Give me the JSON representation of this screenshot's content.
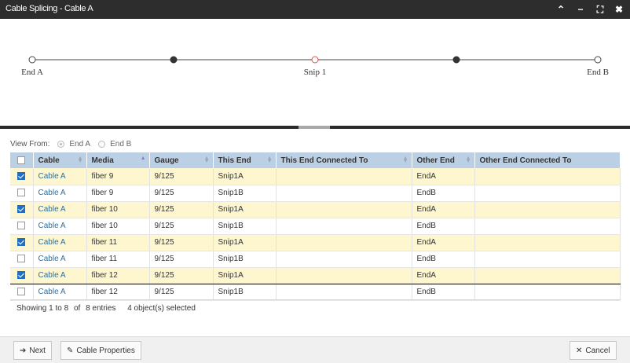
{
  "window": {
    "title": "Cable Splicing - Cable A",
    "controls": {
      "collapse": "⌃",
      "minimize": "−",
      "maximize": "⛶",
      "close": "✖"
    }
  },
  "diagram": {
    "nodes": [
      {
        "label": "End A",
        "style": "open"
      },
      {
        "label": "",
        "style": "filled"
      },
      {
        "label": "Snip 1",
        "style": "open-red"
      },
      {
        "label": "",
        "style": "filled"
      },
      {
        "label": "End B",
        "style": "open"
      }
    ]
  },
  "view_from": {
    "label": "View From:",
    "options": [
      {
        "label": "End A",
        "selected": true
      },
      {
        "label": "End B",
        "selected": false
      }
    ]
  },
  "table": {
    "columns": [
      "Cable",
      "Media",
      "Gauge",
      "This End",
      "This End Connected To",
      "Other End",
      "Other End Connected To"
    ],
    "sorted_column": "Media",
    "rows": [
      {
        "checked": true,
        "cable": "Cable A",
        "media": "fiber 9",
        "gauge": "9/125",
        "this_end": "Snip1A",
        "this_conn": "",
        "other_end": "EndA",
        "other_conn": ""
      },
      {
        "checked": false,
        "cable": "Cable A",
        "media": "fiber 9",
        "gauge": "9/125",
        "this_end": "Snip1B",
        "this_conn": "",
        "other_end": "EndB",
        "other_conn": ""
      },
      {
        "checked": true,
        "cable": "Cable A",
        "media": "fiber 10",
        "gauge": "9/125",
        "this_end": "Snip1A",
        "this_conn": "",
        "other_end": "EndA",
        "other_conn": ""
      },
      {
        "checked": false,
        "cable": "Cable A",
        "media": "fiber 10",
        "gauge": "9/125",
        "this_end": "Snip1B",
        "this_conn": "",
        "other_end": "EndB",
        "other_conn": ""
      },
      {
        "checked": true,
        "cable": "Cable A",
        "media": "fiber 11",
        "gauge": "9/125",
        "this_end": "Snip1A",
        "this_conn": "",
        "other_end": "EndA",
        "other_conn": ""
      },
      {
        "checked": false,
        "cable": "Cable A",
        "media": "fiber 11",
        "gauge": "9/125",
        "this_end": "Snip1B",
        "this_conn": "",
        "other_end": "EndB",
        "other_conn": ""
      },
      {
        "checked": true,
        "cable": "Cable A",
        "media": "fiber 12",
        "gauge": "9/125",
        "this_end": "Snip1A",
        "this_conn": "",
        "other_end": "EndA",
        "other_conn": "",
        "current": true
      },
      {
        "checked": false,
        "cable": "Cable A",
        "media": "fiber 12",
        "gauge": "9/125",
        "this_end": "Snip1B",
        "this_conn": "",
        "other_end": "EndB",
        "other_conn": ""
      }
    ]
  },
  "footer_info": {
    "showing": "Showing 1 to 8",
    "of": "of",
    "entries": "8 entries",
    "selected": "4 object(s) selected"
  },
  "buttons": {
    "next": {
      "label": "Next",
      "icon": "arrow-right-icon"
    },
    "cable_properties": {
      "label": "Cable Properties",
      "icon": "pencil-icon"
    },
    "cancel": {
      "label": "Cancel",
      "icon": "close-icon"
    }
  },
  "colors": {
    "titlebar": "#2d2d2d",
    "header": "#bcd0e5",
    "selected_row": "#fdf6cf",
    "link": "#2c6f9e",
    "checkbox": "#1f6fc5",
    "snip_node": "#d9534f"
  }
}
